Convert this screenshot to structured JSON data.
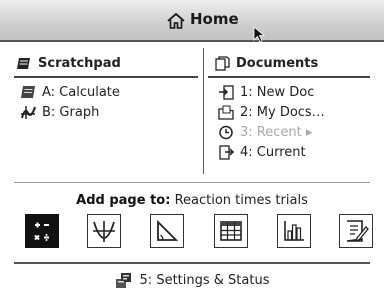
{
  "titlebar": {
    "title": "Home"
  },
  "scratchpad": {
    "heading": "Scratchpad",
    "items": [
      {
        "label": "A: Calculate",
        "icon": "calculate-icon"
      },
      {
        "label": "B: Graph",
        "icon": "graph-icon"
      }
    ]
  },
  "documents": {
    "heading": "Documents",
    "items": [
      {
        "label": "1: New Doc",
        "icon": "new-doc-icon"
      },
      {
        "label": "2: My Docs…",
        "icon": "my-docs-icon"
      },
      {
        "label": "3: Recent ▸",
        "icon": "recent-icon",
        "disabled": true
      },
      {
        "label": "4: Current",
        "icon": "current-icon"
      }
    ]
  },
  "add_page": {
    "prefix": "Add page to:",
    "document_name": "Reaction times trials",
    "apps": [
      "calculator",
      "graphs",
      "geometry",
      "lists-spreadsheet",
      "data-statistics",
      "notes"
    ]
  },
  "settings": {
    "label": "5: Settings & Status",
    "icon": "settings-icon"
  }
}
